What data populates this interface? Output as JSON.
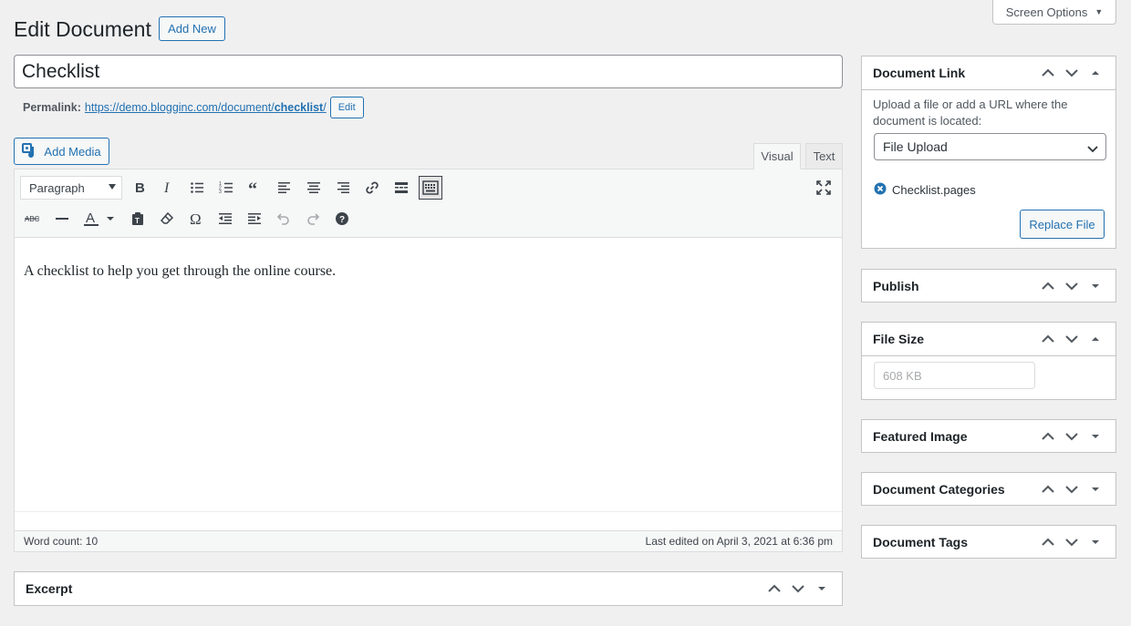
{
  "header": {
    "screen_options": "Screen Options",
    "title": "Edit Document",
    "add_new": "Add New"
  },
  "post": {
    "title": "Checklist",
    "permalink_label": "Permalink:",
    "permalink_base": "https://demo.blogginc.com/document/",
    "permalink_slug": "checklist",
    "permalink_end": "/",
    "permalink_edit": "Edit"
  },
  "editor": {
    "add_media": "Add Media",
    "tabs": {
      "visual": "Visual",
      "text": "Text"
    },
    "format": "Paragraph",
    "content": "A checklist to help you get through the online course.",
    "word_count": "Word count: 10",
    "last_edited": "Last edited on April 3, 2021 at 6:36 pm",
    "toolbar_icons": [
      "bold-icon",
      "italic-icon",
      "bullet-list-icon",
      "numbered-list-icon",
      "blockquote-icon",
      "align-left-icon",
      "align-center-icon",
      "align-right-icon",
      "link-icon",
      "read-more-icon",
      "toolbar-toggle-icon",
      "fullscreen-icon",
      "strikethrough-icon",
      "horizontal-line-icon",
      "text-color-icon",
      "paste-text-icon",
      "clear-formatting-icon",
      "special-character-icon",
      "outdent-icon",
      "indent-icon",
      "undo-icon",
      "redo-icon",
      "help-icon"
    ]
  },
  "excerpt": {
    "title": "Excerpt"
  },
  "sidebar": {
    "document_link": {
      "title": "Document Link",
      "description": "Upload a file or add a URL where the document is located:",
      "select_value": "File Upload",
      "file_name": "Checklist.pages",
      "replace_button": "Replace File"
    },
    "publish": {
      "title": "Publish"
    },
    "file_size": {
      "title": "File Size",
      "placeholder": "608 KB"
    },
    "featured_image": {
      "title": "Featured Image"
    },
    "document_categories": {
      "title": "Document Categories"
    },
    "document_tags": {
      "title": "Document Tags"
    }
  },
  "colors": {
    "accent": "#2271b1",
    "background": "#f0f0f1",
    "border": "#c3c4c7"
  }
}
